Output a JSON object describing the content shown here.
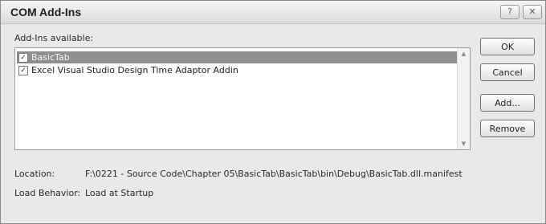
{
  "window": {
    "title": "COM Add-Ins",
    "help_glyph": "?",
    "close_glyph": "✕"
  },
  "addins": {
    "label": "Add-Ins available:",
    "items": [
      {
        "name": "BasicTab",
        "checked": true,
        "selected": true
      },
      {
        "name": "Excel Visual Studio Design Time Adaptor Addin",
        "checked": true,
        "selected": false
      }
    ],
    "check_glyph": "✓"
  },
  "buttons": {
    "ok": "OK",
    "cancel": "Cancel",
    "add": "Add...",
    "remove": "Remove"
  },
  "details": {
    "location_label": "Location:",
    "location_value": "F:\\0221 - Source Code\\Chapter 05\\BasicTab\\BasicTab\\bin\\Debug\\BasicTab.dll.manifest",
    "load_behavior_label": "Load Behavior:",
    "load_behavior_value": "Load at Startup"
  }
}
